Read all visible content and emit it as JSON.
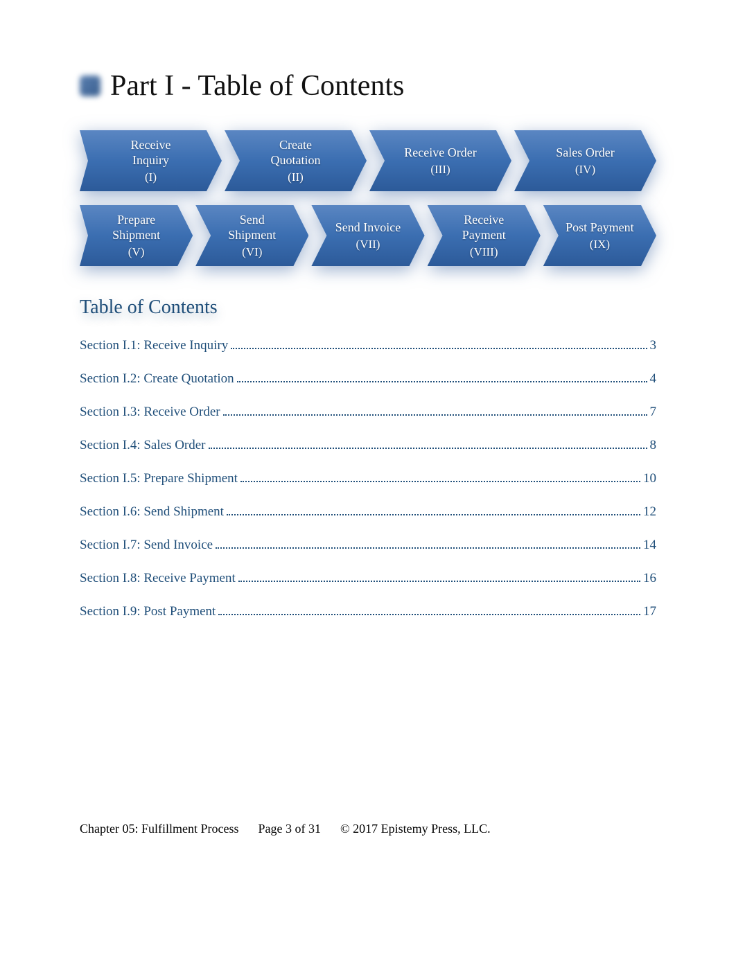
{
  "heading": "Part I - Table of Contents",
  "process": {
    "row1": [
      {
        "label": "Receive\nInquiry",
        "roman": "(I)"
      },
      {
        "label": "Create\nQuotation",
        "roman": "(II)"
      },
      {
        "label": "Receive Order",
        "roman": "(III)"
      },
      {
        "label": "Sales Order",
        "roman": "(IV)"
      }
    ],
    "row2": [
      {
        "label": "Prepare\nShipment",
        "roman": "(V)"
      },
      {
        "label": "Send\nShipment",
        "roman": "(VI)"
      },
      {
        "label": "Send Invoice",
        "roman": "(VII)"
      },
      {
        "label": "Receive\nPayment",
        "roman": "(VIII)"
      },
      {
        "label": "Post Payment",
        "roman": "(IX)"
      }
    ]
  },
  "toc_heading": "Table of Contents",
  "toc": [
    {
      "title": "Section I.1: Receive Inquiry",
      "page": "3"
    },
    {
      "title": "Section I.2: Create Quotation",
      "page": "4"
    },
    {
      "title": "Section I.3: Receive Order",
      "page": "7"
    },
    {
      "title": "Section I.4: Sales Order",
      "page": "8"
    },
    {
      "title": "Section I.5: Prepare Shipment",
      "page": "10"
    },
    {
      "title": "Section I.6: Send Shipment",
      "page": "12"
    },
    {
      "title": "Section I.7: Send Invoice",
      "page": "14"
    },
    {
      "title": "Section I.8: Receive Payment",
      "page": "16"
    },
    {
      "title": "Section I.9: Post Payment",
      "page": "17"
    }
  ],
  "footer": {
    "chapter": "Chapter 05: Fulfillment Process",
    "page": "Page 3 of 31",
    "copyright": "© 2017 Epistemy Press, LLC."
  }
}
